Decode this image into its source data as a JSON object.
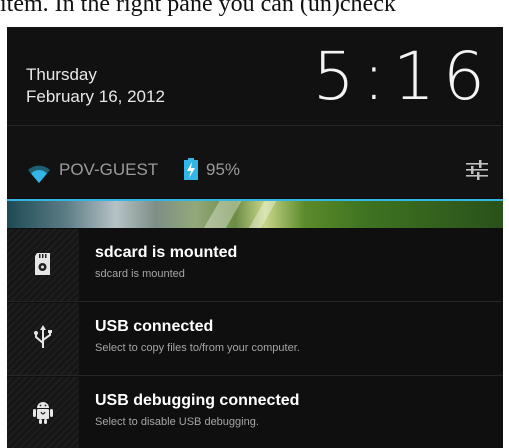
{
  "caption": "item. In the right pane you can (un)check",
  "header": {
    "day": "Thursday",
    "date": "February 16, 2012",
    "time": "5:16"
  },
  "status": {
    "wifi_icon": "wifi-icon",
    "ssid": "POV-GUEST",
    "battery_icon": "battery-charging-icon",
    "battery_percent": "95%",
    "battery_level": 0.95,
    "settings_icon": "quick-settings-icon"
  },
  "accent_color": "#33b5e5",
  "notifications": [
    {
      "icon": "sdcard-icon",
      "title": "sdcard is mounted",
      "subtitle": "sdcard is mounted"
    },
    {
      "icon": "usb-icon",
      "title": "USB connected",
      "subtitle": "Select to copy files to/from your computer."
    },
    {
      "icon": "android-debug-icon",
      "title": "USB debugging connected",
      "subtitle": "Select to disable USB debugging."
    }
  ]
}
